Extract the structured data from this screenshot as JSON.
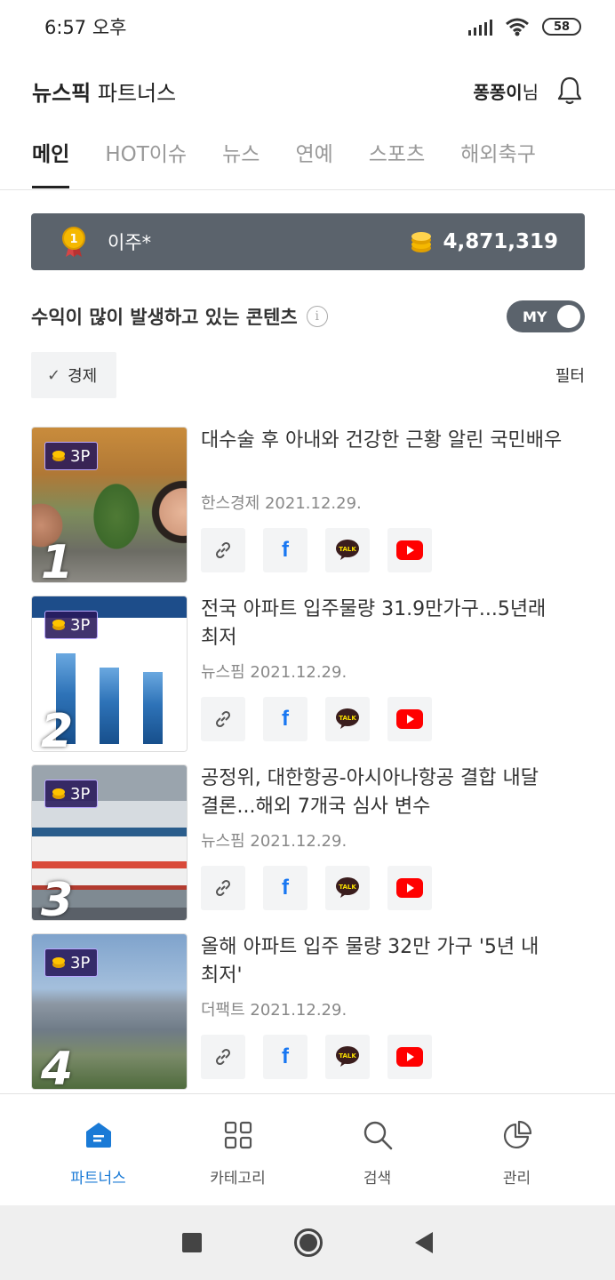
{
  "status_bar": {
    "time": "6:57 오후",
    "battery": "58"
  },
  "header": {
    "brand_bold": "뉴스픽",
    "brand_rest": " 파트너스",
    "user_name": "퐁퐁이",
    "user_suffix": "님"
  },
  "tabs": [
    {
      "label": "메인",
      "active": true
    },
    {
      "label": "HOT이슈"
    },
    {
      "label": "뉴스"
    },
    {
      "label": "연예"
    },
    {
      "label": "스포츠"
    },
    {
      "label": "해외축구"
    }
  ],
  "rank_banner": {
    "name": "이주*",
    "points": "4,871,319"
  },
  "section": {
    "title": "수익이 많이 발생하고 있는 콘텐츠",
    "info_glyph": "i",
    "toggle_label": "MY"
  },
  "filter": {
    "chip_label": "경제",
    "filter_label": "필터"
  },
  "items": [
    {
      "rank": "1",
      "badge": "3P",
      "title": "대수술 후 아내와 건강한 근황 알린 국민배우",
      "meta": "한스경제 2021.12.29."
    },
    {
      "rank": "2",
      "badge": "3P",
      "title": "전국 아파트 입주물량 31.9만가구...5년래 최저",
      "meta": "뉴스핌 2021.12.29."
    },
    {
      "rank": "3",
      "badge": "3P",
      "title": "공정위, 대한항공-아시아나항공 결합 내달 결론...해외 7개국 심사 변수",
      "meta": "뉴스핌 2021.12.29."
    },
    {
      "rank": "4",
      "badge": "3P",
      "title": "올해 아파트 입주 물량 32만 가구 '5년 내 최저'",
      "meta": "더팩트 2021.12.29."
    }
  ],
  "share": {
    "facebook_glyph": "f",
    "kakao_text": "TALK"
  },
  "bottom_nav": [
    {
      "label": "파트너스",
      "icon": "home-icon",
      "active": true
    },
    {
      "label": "카테고리",
      "icon": "grid-icon"
    },
    {
      "label": "검색",
      "icon": "search-icon"
    },
    {
      "label": "관리",
      "icon": "pie-chart-icon"
    }
  ],
  "colors": {
    "banner": "#5b636c",
    "active_nav": "#1a7ad6",
    "coin": "#f5b800",
    "youtube": "#ff0000",
    "facebook": "#1877f2"
  }
}
